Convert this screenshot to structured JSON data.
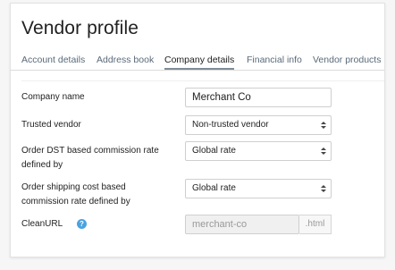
{
  "page": {
    "title": "Vendor profile"
  },
  "tabs": [
    {
      "label": "Account details",
      "active": false
    },
    {
      "label": "Address book",
      "active": false
    },
    {
      "label": "Company details",
      "active": true
    },
    {
      "label": "Financial info",
      "active": false
    },
    {
      "label": "Vendor products",
      "active": false
    }
  ],
  "form": {
    "company_name": {
      "label": "Company name",
      "value": "Merchant Co"
    },
    "trusted_vendor": {
      "label": "Trusted vendor",
      "value": "Non-trusted vendor"
    },
    "dst_commission": {
      "label": "Order DST based commission rate defined by",
      "value": "Global rate"
    },
    "shipping_commission": {
      "label": "Order shipping cost based commission rate defined by",
      "value": "Global rate"
    },
    "clean_url": {
      "label": "CleanURL",
      "help": "?",
      "value": "merchant-co",
      "suffix": ".html"
    }
  },
  "colors": {
    "help_icon": "#4aa3df",
    "active_tab_underline": "#7f8c97",
    "tab_text": "#5a6a7a"
  }
}
